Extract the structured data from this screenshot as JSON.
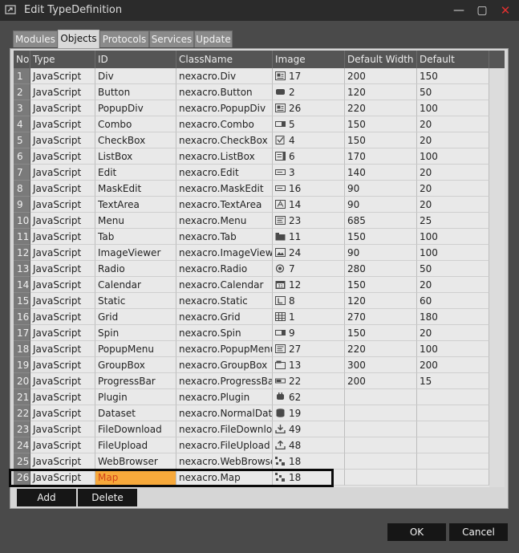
{
  "window": {
    "title": "Edit TypeDefinition",
    "minimize": "—",
    "maximize": "▢",
    "close": "✕"
  },
  "tabs": [
    {
      "label": "Modules"
    },
    {
      "label": "Objects"
    },
    {
      "label": "Protocols"
    },
    {
      "label": "Services"
    },
    {
      "label": "Update"
    }
  ],
  "columns": [
    "No",
    "Type",
    "ID",
    "ClassName",
    "Image",
    "Default Width",
    "Default Height"
  ],
  "rows": [
    {
      "no": "1",
      "type": "JavaScript",
      "id": "Div",
      "cls": "nexacro.Div",
      "img": "17",
      "icon": "div-icon",
      "w": "200",
      "h": "150"
    },
    {
      "no": "2",
      "type": "JavaScript",
      "id": "Button",
      "cls": "nexacro.Button",
      "img": "2",
      "icon": "button-icon",
      "w": "120",
      "h": "50"
    },
    {
      "no": "3",
      "type": "JavaScript",
      "id": "PopupDiv",
      "cls": "nexacro.PopupDiv",
      "img": "26",
      "icon": "popupdiv-icon",
      "w": "220",
      "h": "100"
    },
    {
      "no": "4",
      "type": "JavaScript",
      "id": "Combo",
      "cls": "nexacro.Combo",
      "img": "5",
      "icon": "combo-icon",
      "w": "150",
      "h": "20"
    },
    {
      "no": "5",
      "type": "JavaScript",
      "id": "CheckBox",
      "cls": "nexacro.CheckBox",
      "img": "4",
      "icon": "checkbox-icon",
      "w": "150",
      "h": "20"
    },
    {
      "no": "6",
      "type": "JavaScript",
      "id": "ListBox",
      "cls": "nexacro.ListBox",
      "img": "6",
      "icon": "listbox-icon",
      "w": "170",
      "h": "100"
    },
    {
      "no": "7",
      "type": "JavaScript",
      "id": "Edit",
      "cls": "nexacro.Edit",
      "img": "3",
      "icon": "edit-icon",
      "w": "140",
      "h": "20"
    },
    {
      "no": "8",
      "type": "JavaScript",
      "id": "MaskEdit",
      "cls": "nexacro.MaskEdit",
      "img": "16",
      "icon": "maskedit-icon",
      "w": "90",
      "h": "20"
    },
    {
      "no": "9",
      "type": "JavaScript",
      "id": "TextArea",
      "cls": "nexacro.TextArea",
      "img": "14",
      "icon": "textarea-icon",
      "w": "90",
      "h": "20"
    },
    {
      "no": "10",
      "type": "JavaScript",
      "id": "Menu",
      "cls": "nexacro.Menu",
      "img": "23",
      "icon": "menu-icon",
      "w": "685",
      "h": "25"
    },
    {
      "no": "11",
      "type": "JavaScript",
      "id": "Tab",
      "cls": "nexacro.Tab",
      "img": "11",
      "icon": "tab-icon",
      "w": "150",
      "h": "100"
    },
    {
      "no": "12",
      "type": "JavaScript",
      "id": "ImageViewer",
      "cls": "nexacro.ImageViewer",
      "img": "24",
      "icon": "imageviewer-icon",
      "w": "90",
      "h": "100"
    },
    {
      "no": "13",
      "type": "JavaScript",
      "id": "Radio",
      "cls": "nexacro.Radio",
      "img": "7",
      "icon": "radio-icon",
      "w": "280",
      "h": "50"
    },
    {
      "no": "14",
      "type": "JavaScript",
      "id": "Calendar",
      "cls": "nexacro.Calendar",
      "img": "12",
      "icon": "calendar-icon",
      "w": "150",
      "h": "20"
    },
    {
      "no": "15",
      "type": "JavaScript",
      "id": "Static",
      "cls": "nexacro.Static",
      "img": "8",
      "icon": "static-icon",
      "w": "120",
      "h": "60"
    },
    {
      "no": "16",
      "type": "JavaScript",
      "id": "Grid",
      "cls": "nexacro.Grid",
      "img": "1",
      "icon": "grid-icon",
      "w": "270",
      "h": "180"
    },
    {
      "no": "17",
      "type": "JavaScript",
      "id": "Spin",
      "cls": "nexacro.Spin",
      "img": "9",
      "icon": "spin-icon",
      "w": "150",
      "h": "20"
    },
    {
      "no": "18",
      "type": "JavaScript",
      "id": "PopupMenu",
      "cls": "nexacro.PopupMenu",
      "img": "27",
      "icon": "popupmenu-icon",
      "w": "220",
      "h": "100"
    },
    {
      "no": "19",
      "type": "JavaScript",
      "id": "GroupBox",
      "cls": "nexacro.GroupBox",
      "img": "13",
      "icon": "groupbox-icon",
      "w": "300",
      "h": "200"
    },
    {
      "no": "20",
      "type": "JavaScript",
      "id": "ProgressBar",
      "cls": "nexacro.ProgressBar",
      "img": "22",
      "icon": "progressbar-icon",
      "w": "200",
      "h": "15"
    },
    {
      "no": "21",
      "type": "JavaScript",
      "id": "Plugin",
      "cls": "nexacro.Plugin",
      "img": "62",
      "icon": "plugin-icon",
      "w": "",
      "h": ""
    },
    {
      "no": "22",
      "type": "JavaScript",
      "id": "Dataset",
      "cls": "nexacro.NormalDat...",
      "img": "19",
      "icon": "dataset-icon",
      "w": "",
      "h": ""
    },
    {
      "no": "23",
      "type": "JavaScript",
      "id": "FileDownload",
      "cls": "nexacro.FileDownlo...",
      "img": "49",
      "icon": "filedownload-icon",
      "w": "",
      "h": ""
    },
    {
      "no": "24",
      "type": "JavaScript",
      "id": "FileUpload",
      "cls": "nexacro.FileUpload",
      "img": "48",
      "icon": "fileupload-icon",
      "w": "",
      "h": ""
    },
    {
      "no": "25",
      "type": "JavaScript",
      "id": "WebBrowser",
      "cls": "nexacro.WebBrowser",
      "img": "18",
      "icon": "webbrowser-icon",
      "w": "",
      "h": ""
    },
    {
      "no": "26",
      "type": "JavaScript",
      "id": "Map",
      "cls": "nexacro.Map",
      "img": "18",
      "icon": "map-icon",
      "w": "",
      "h": ""
    }
  ],
  "buttons": {
    "add": "Add",
    "delete": "Delete",
    "ok": "OK",
    "cancel": "Cancel"
  }
}
